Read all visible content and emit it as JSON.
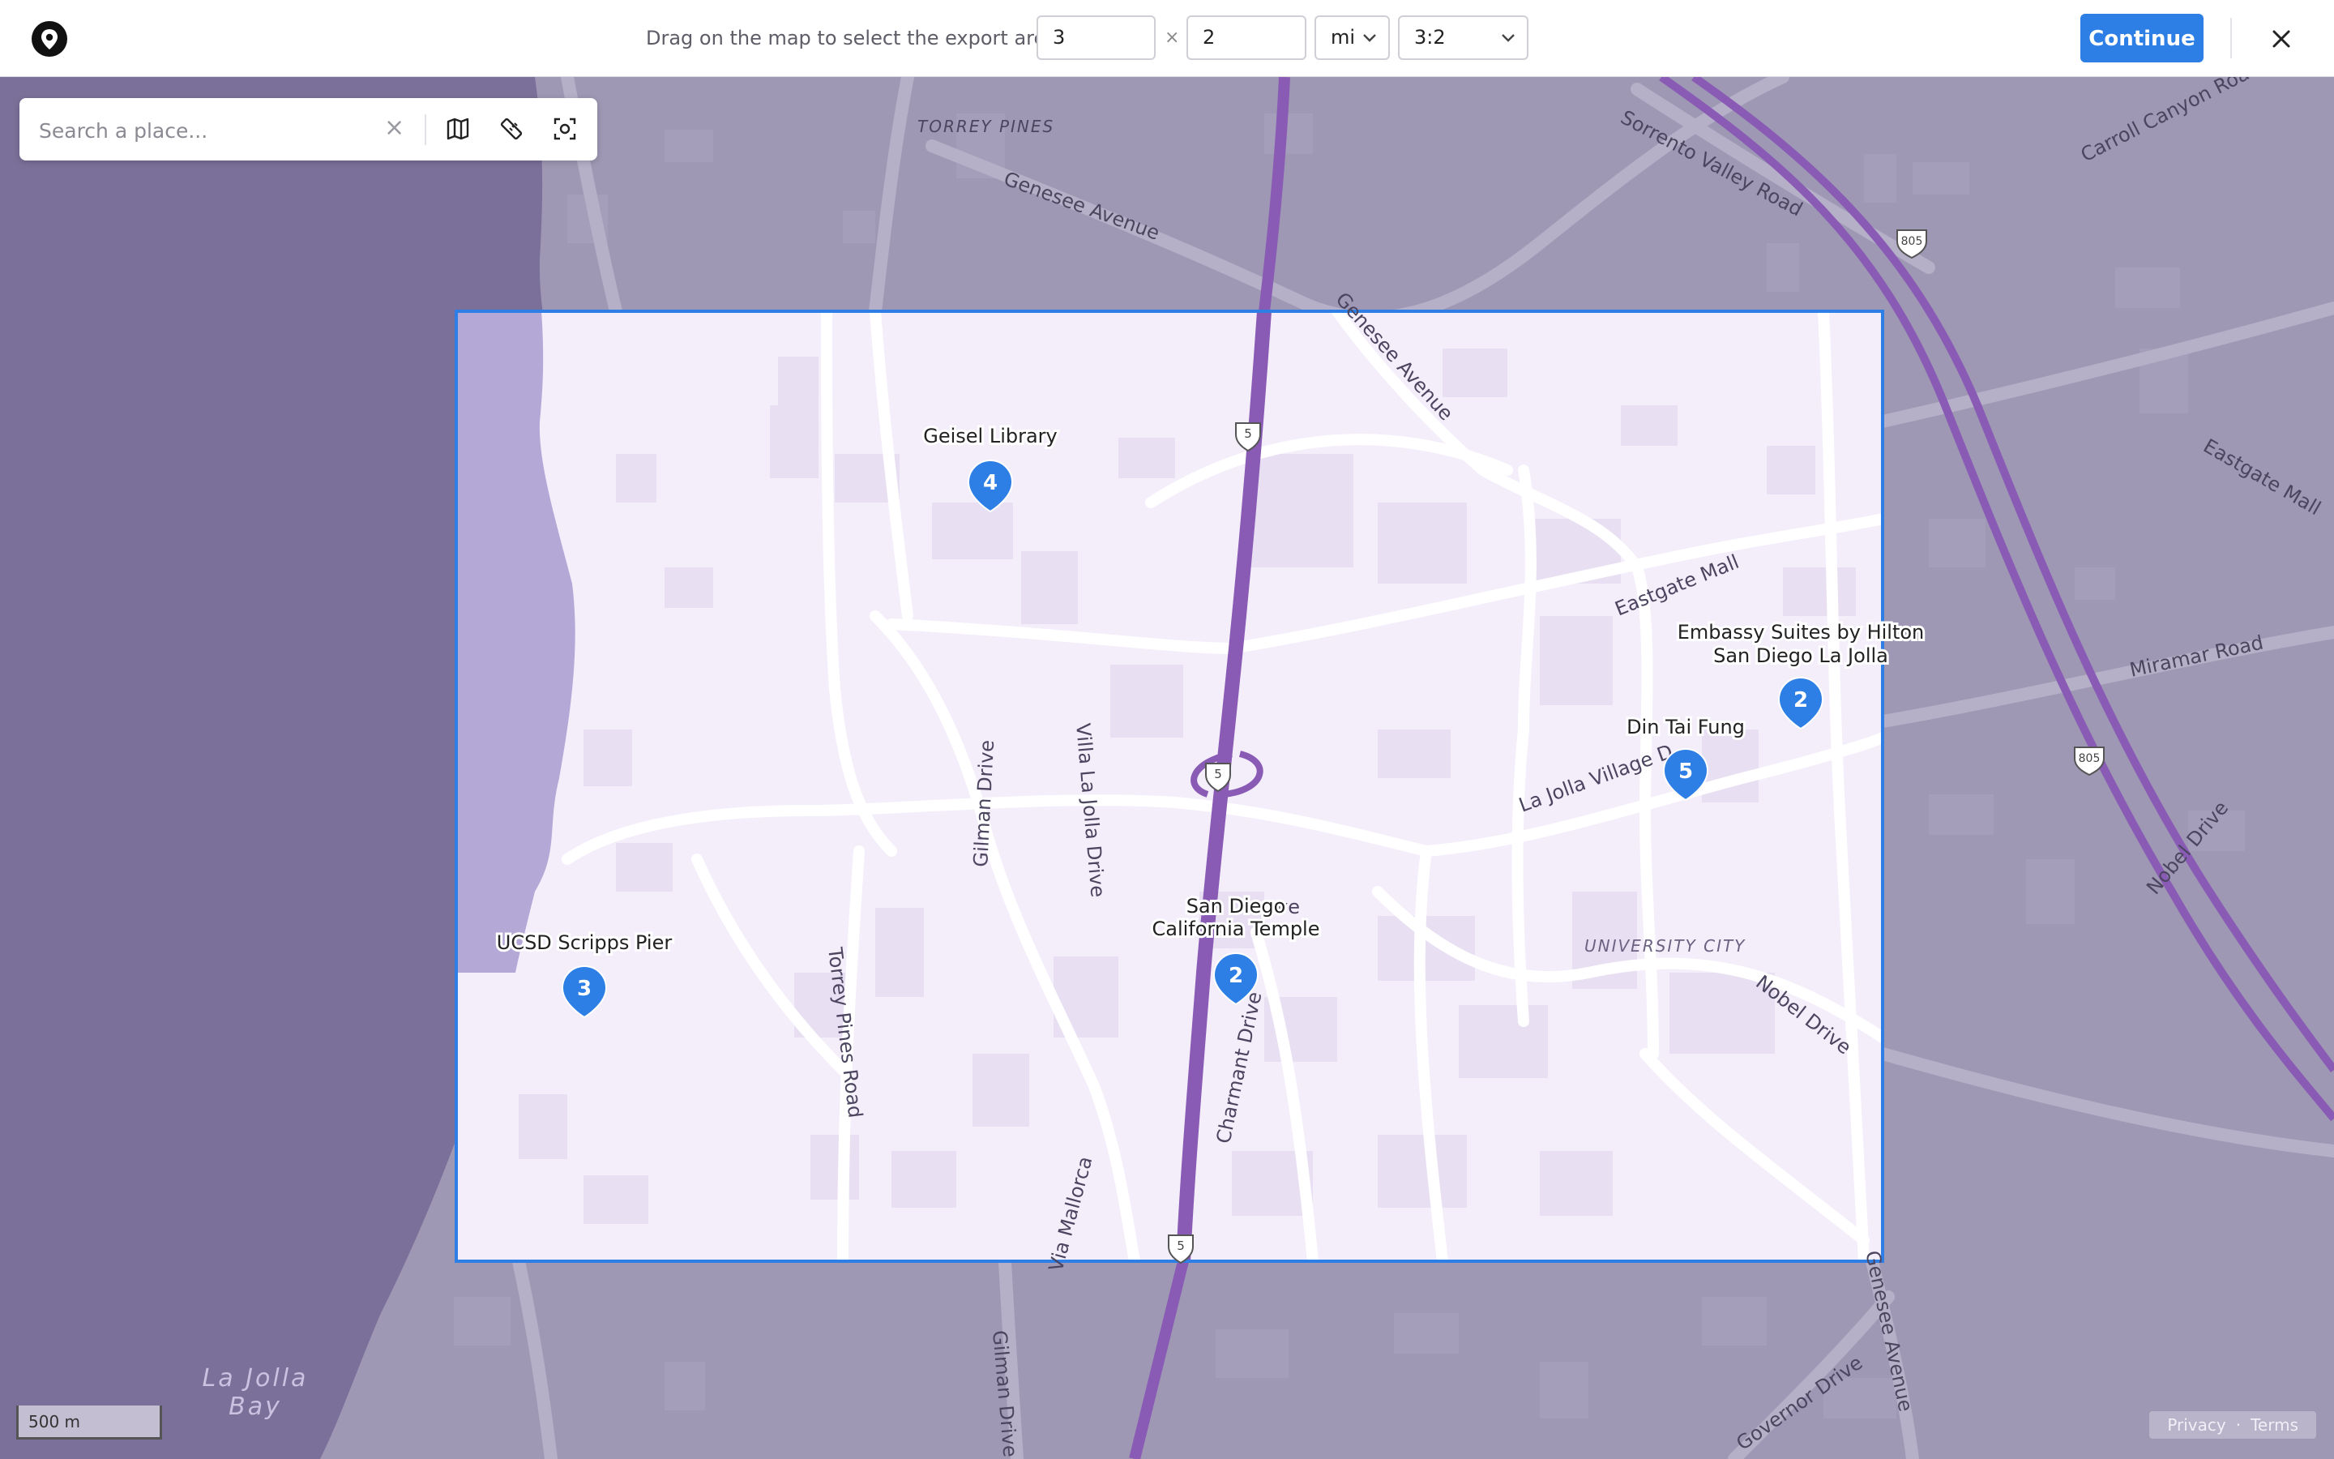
{
  "toolbar": {
    "hint": "Drag on the map to select the export area",
    "width_value": "3",
    "times_sign": "×",
    "height_value": "2",
    "unit_selected": "mi",
    "ratio_selected": "3:2",
    "continue_label": "Continue"
  },
  "search": {
    "placeholder": "Search a place...",
    "clear_symbol": "×"
  },
  "map": {
    "scale_label": "500 m",
    "privacy": "Privacy",
    "separator": "·",
    "terms": "Terms",
    "areas": {
      "torrey_pines": "TORREY PINES",
      "university_city": "UNIVERSITY CITY",
      "la_jolla_bay_1": "La Jolla",
      "la_jolla_bay_2": "Bay"
    },
    "roads": {
      "sorrento_valley": "Sorrento Valley Road",
      "carroll_canyon": "Carroll Canyon Road",
      "genesee_1": "Genesee Avenue",
      "genesee_2": "Genesee Avenue",
      "genesee_3": "Genesee Avenue",
      "eastgate_1": "Eastgate Mall",
      "eastgate_2": "Eastgate Mall",
      "miramar": "Miramar Road",
      "la_jolla_village": "La Jolla Village D",
      "nobel_1": "Nobel Drive",
      "nobel_2": "Nobel Drive",
      "gilman_1": "Gilman Drive",
      "gilman_2": "Gilman Drive",
      "villa_la_jolla": "Villa La Jolla Drive",
      "torrey_pines_road": "Torrey Pines Road",
      "via_mallorca": "Via Mallorca",
      "charmant": "Charmant Drive",
      "governor": "Governor Drive",
      "partial_ve": "ve"
    },
    "shields": {
      "i5": "5",
      "i805": "805"
    },
    "markers": [
      {
        "label_1": "Geisel Library",
        "label_2": "",
        "number": "4"
      },
      {
        "label_1": "Embassy Suites by Hilton",
        "label_2": "San Diego La Jolla",
        "number": "2"
      },
      {
        "label_1": "Din Tai Fung",
        "label_2": "",
        "number": "5"
      },
      {
        "label_1": "San Diego",
        "label_2": "California Temple",
        "number": "2"
      },
      {
        "label_1": "UCSD Scripps Pier",
        "label_2": "",
        "number": "3"
      }
    ]
  },
  "colors": {
    "accent": "#2d7fe5",
    "water": "#7b7099",
    "land_dim": "#9e98b4",
    "selection_fill": "#f4eefb",
    "highway": "#8a5bb5"
  }
}
